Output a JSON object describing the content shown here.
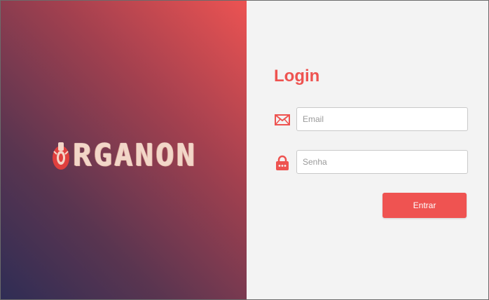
{
  "app": {
    "logo_text": "RGANON",
    "logo_full": "ORGANON"
  },
  "login": {
    "title": "Login",
    "email": {
      "placeholder": "Email",
      "value": "",
      "icon": "envelope-icon"
    },
    "password": {
      "placeholder": "Senha",
      "value": "",
      "icon": "lock-icon"
    },
    "submit_label": "Entrar"
  },
  "colors": {
    "accent": "#ee5350",
    "gradient_start": "#2f2d55",
    "gradient_end": "#ec5352",
    "panel_bg": "#f3f3f3"
  }
}
